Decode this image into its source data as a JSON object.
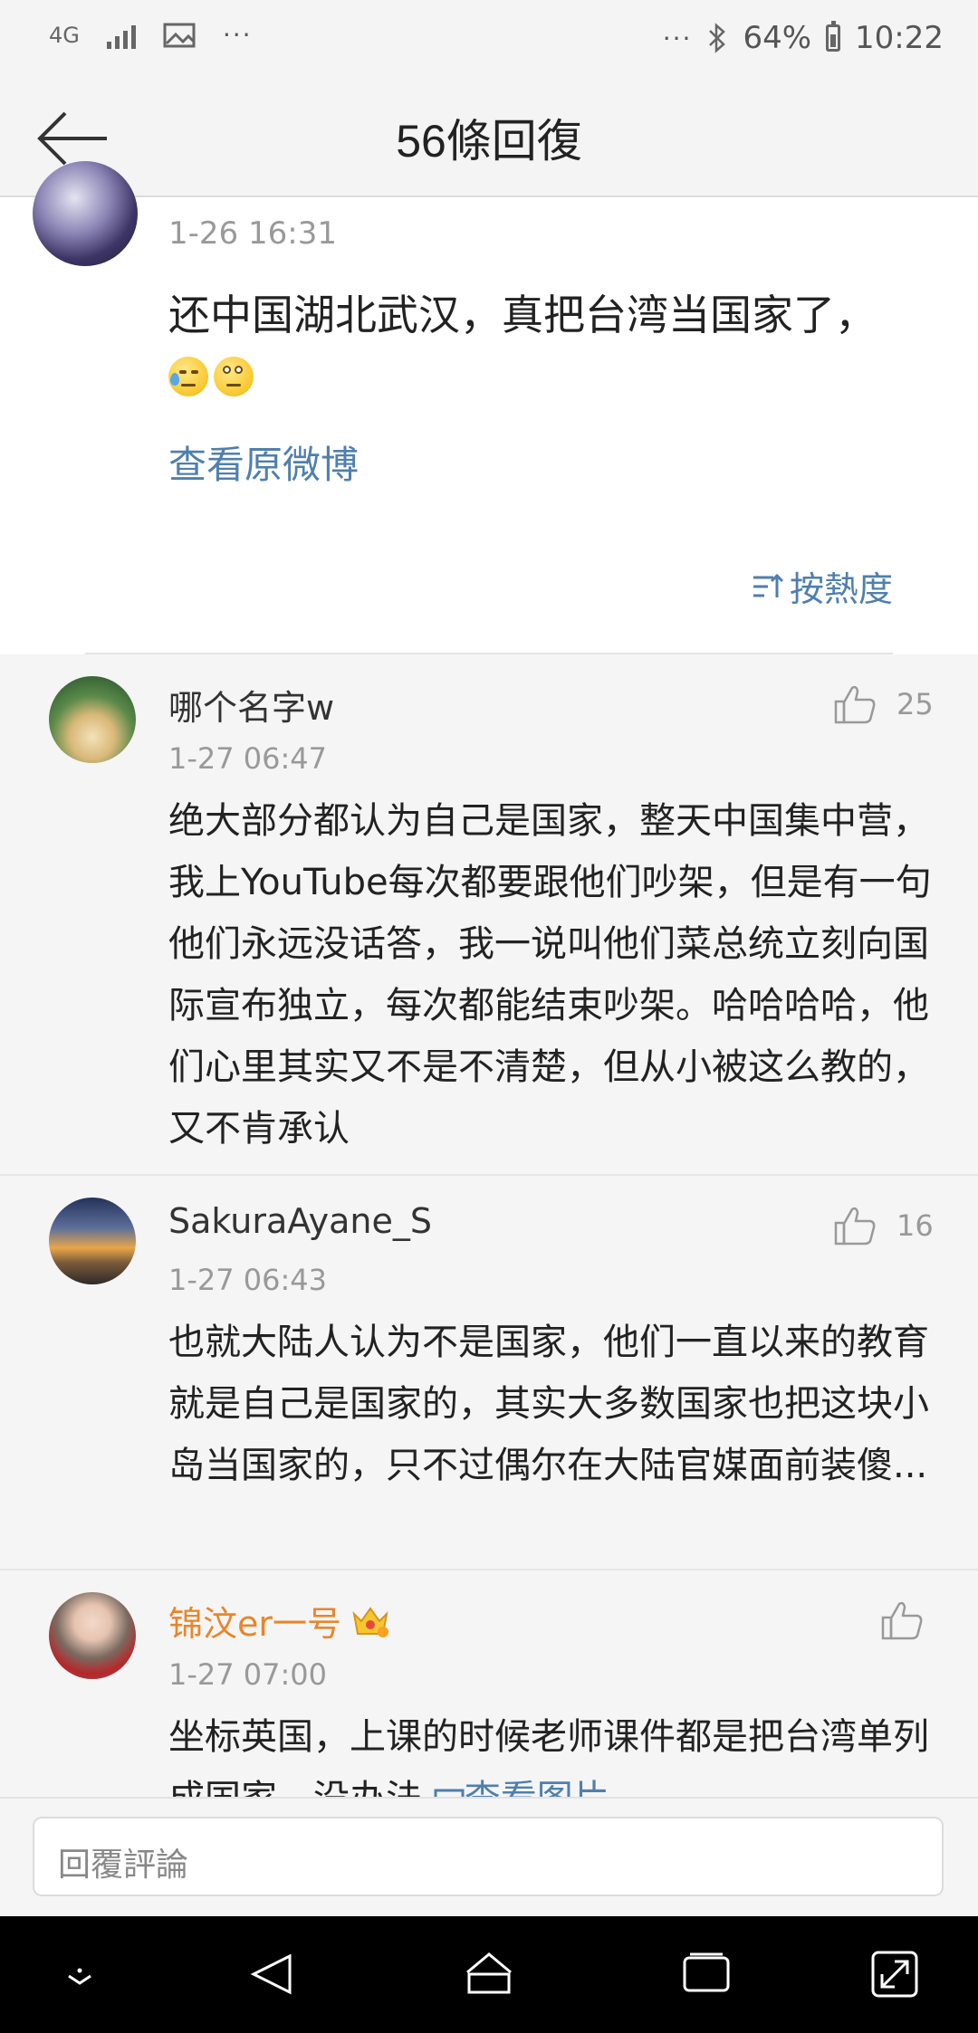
{
  "status_bar": {
    "network": "4G",
    "battery": "64%",
    "time": "10:22",
    "icons": [
      "signal-icon",
      "image-icon",
      "more-icon",
      "bluetooth-icon",
      "battery-icon"
    ]
  },
  "header": {
    "title": "56條回復"
  },
  "original_post": {
    "time": "1-26 16:31",
    "text": "还中国湖北武汉，真把台湾当国家了，",
    "emojis": [
      "sweat-emoji",
      "eye-roll-emoji"
    ],
    "view_original": "查看原微博"
  },
  "sort": {
    "label": "按熱度"
  },
  "comments": [
    {
      "name": "哪个名字w",
      "time": "1-27 06:47",
      "likes": "25",
      "text": "绝大部分都认为自己是国家，整天中国集中营，我上YouTube每次都要跟他们吵架，但是有一句他们永远没话答，我一说叫他们菜总统立刻向国际宣布独立，每次都能结束吵架。哈哈哈哈，他们心里其实又不是不清楚，但从小被这么教的，又不肯承认"
    },
    {
      "name": "SakuraAyane_S",
      "time": "1-27 06:43",
      "likes": "16",
      "text": "也就大陆人认为不是国家，他们一直以来的教育就是自己是国家的，其实大多数国家也把这块小岛当国家的，只不过偶尔在大陆官媒面前装傻..."
    },
    {
      "name": "锦汶er一号",
      "time": "1-27 07:00",
      "likes": "",
      "text": "坐标英国，上课的时候老师课件都是把台湾单列成国家，没办法 ",
      "image_link": "查看图片",
      "colors": {
        "name": "#e8862a"
      }
    }
  ],
  "reply_bar": {
    "placeholder": "回覆評論"
  },
  "colors": {
    "link": "#4f7fae",
    "vip_name": "#e8862a"
  }
}
